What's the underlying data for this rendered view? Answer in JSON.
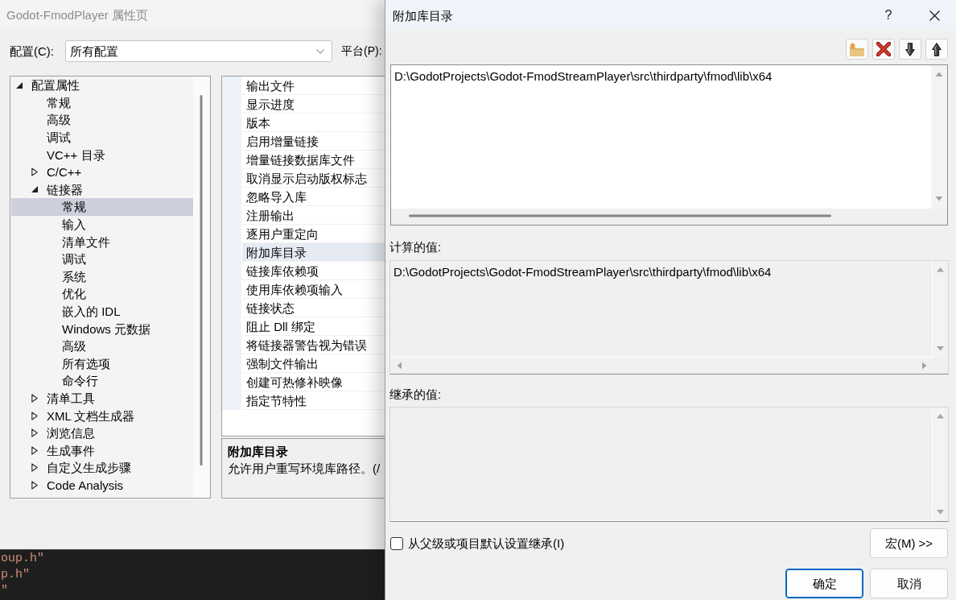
{
  "property_window": {
    "title": "Godot-FmodPlayer 属性页",
    "configuration": {
      "label": "配置(C):",
      "value": "所有配置"
    },
    "platform": {
      "label": "平台(P):"
    },
    "tree": [
      {
        "label": "配置属性",
        "expanded": true,
        "selected": false,
        "children": [
          {
            "label": "常规",
            "selected": false
          },
          {
            "label": "高级",
            "selected": false
          },
          {
            "label": "调试",
            "selected": false
          },
          {
            "label": "VC++ 目录",
            "selected": false
          },
          {
            "label": "C/C++",
            "expanded": false,
            "selected": false
          },
          {
            "label": "链接器",
            "expanded": true,
            "selected": false,
            "children": [
              {
                "label": "常规",
                "selected": true
              },
              {
                "label": "输入",
                "selected": false
              },
              {
                "label": "清单文件",
                "selected": false
              },
              {
                "label": "调试",
                "selected": false
              },
              {
                "label": "系统",
                "selected": false
              },
              {
                "label": "优化",
                "selected": false
              },
              {
                "label": "嵌入的 IDL",
                "selected": false
              },
              {
                "label": "Windows 元数据",
                "selected": false
              },
              {
                "label": "高级",
                "selected": false
              },
              {
                "label": "所有选项",
                "selected": false
              },
              {
                "label": "命令行",
                "selected": false
              }
            ]
          },
          {
            "label": "清单工具",
            "expanded": false,
            "selected": false
          },
          {
            "label": "XML 文档生成器",
            "expanded": false,
            "selected": false
          },
          {
            "label": "浏览信息",
            "expanded": false,
            "selected": false
          },
          {
            "label": "生成事件",
            "expanded": false,
            "selected": false
          },
          {
            "label": "自定义生成步骤",
            "expanded": false,
            "selected": false
          },
          {
            "label": "Code Analysis",
            "expanded": false,
            "selected": false
          }
        ]
      }
    ],
    "properties": [
      {
        "label": "输出文件",
        "selected": false
      },
      {
        "label": "显示进度",
        "selected": false
      },
      {
        "label": "版本",
        "selected": false
      },
      {
        "label": "启用增量链接",
        "selected": false
      },
      {
        "label": "增量链接数据库文件",
        "selected": false
      },
      {
        "label": "取消显示启动版权标志",
        "selected": false
      },
      {
        "label": "忽略导入库",
        "selected": false
      },
      {
        "label": "注册输出",
        "selected": false
      },
      {
        "label": "逐用户重定向",
        "selected": false
      },
      {
        "label": "附加库目录",
        "selected": true
      },
      {
        "label": "链接库依赖项",
        "selected": false
      },
      {
        "label": "使用库依赖项输入",
        "selected": false
      },
      {
        "label": "链接状态",
        "selected": false
      },
      {
        "label": "阻止 Dll 绑定",
        "selected": false
      },
      {
        "label": "将链接器警告视为错误",
        "selected": false
      },
      {
        "label": "强制文件输出",
        "selected": false
      },
      {
        "label": "创建可热修补映像",
        "selected": false
      },
      {
        "label": "指定节特性",
        "selected": false
      }
    ],
    "description": {
      "title": "附加库目录",
      "text": "允许用户重写环境库路径。(/"
    }
  },
  "code_editor": {
    "lines": [
      "oup.h\"",
      "p.h\"",
      "\""
    ]
  },
  "dialog": {
    "title": "附加库目录",
    "help": "?",
    "edit_value": "D:\\GodotProjects\\Godot-FmodStreamPlayer\\src\\thirdparty\\fmod\\lib\\x64",
    "computed": {
      "label": "计算的值:",
      "value": "D:\\GodotProjects\\Godot-FmodStreamPlayer\\src\\thirdparty\\fmod\\lib\\x64"
    },
    "inherited": {
      "label": "继承的值:"
    },
    "inherit_checkbox": {
      "label": "从父级或项目默认设置继承(I)",
      "checked": false
    },
    "macro_button": "宏(M) >>",
    "footer_buttons": [
      {
        "label": "确定",
        "default": true
      },
      {
        "label": "取消",
        "default": false
      }
    ]
  }
}
